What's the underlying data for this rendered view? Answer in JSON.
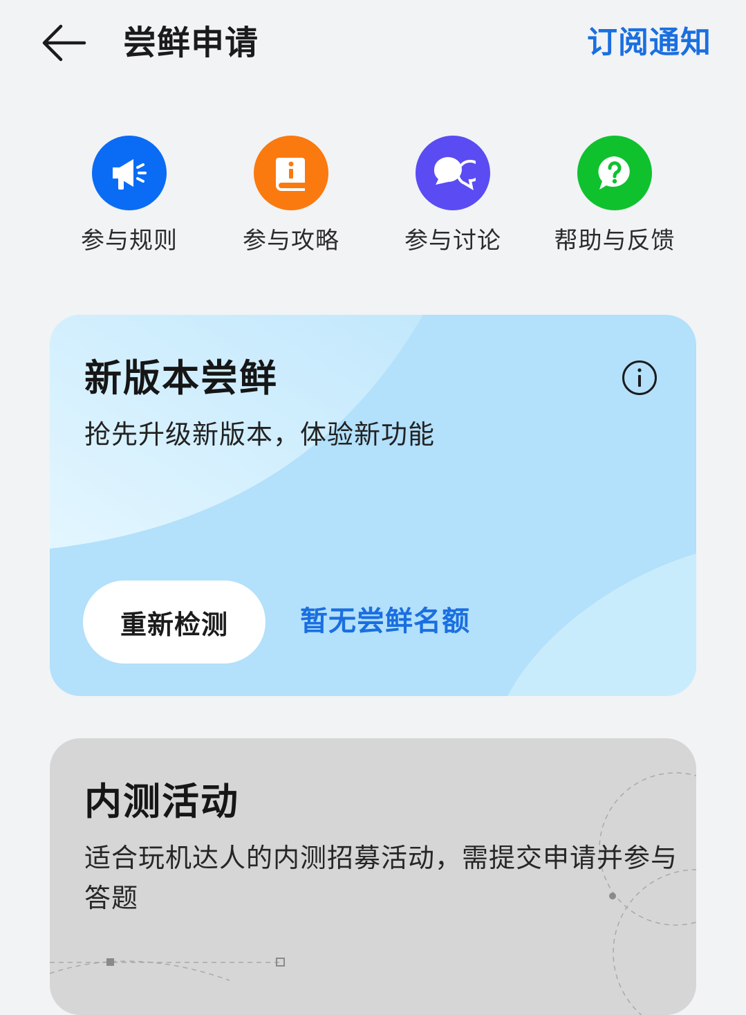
{
  "header": {
    "title": "尝鲜申请",
    "subscribe_label": "订阅通知"
  },
  "quick_entries": [
    {
      "label": "参与规则",
      "icon": "megaphone-icon",
      "color": "#0a6cf5"
    },
    {
      "label": "参与攻略",
      "icon": "book-info-icon",
      "color": "#fa7a0f"
    },
    {
      "label": "参与讨论",
      "icon": "chat-bubbles-icon",
      "color": "#5a4cf2"
    },
    {
      "label": "帮助与反馈",
      "icon": "help-bubble-icon",
      "color": "#10c12e"
    }
  ],
  "new_version_card": {
    "title": "新版本尝鲜",
    "description": "抢先升级新版本，体验新功能",
    "recheck_label": "重新检测",
    "quota_status": "暂无尝鲜名额",
    "background_color": "#b3e0fa"
  },
  "beta_card": {
    "title": "内测活动",
    "description": "适合玩机达人的内测招募活动，需提交申请并参与答题",
    "background_color": "#d6d6d6"
  },
  "colors": {
    "accent": "#1a6fe0",
    "page_background": "#f1f3f5"
  }
}
